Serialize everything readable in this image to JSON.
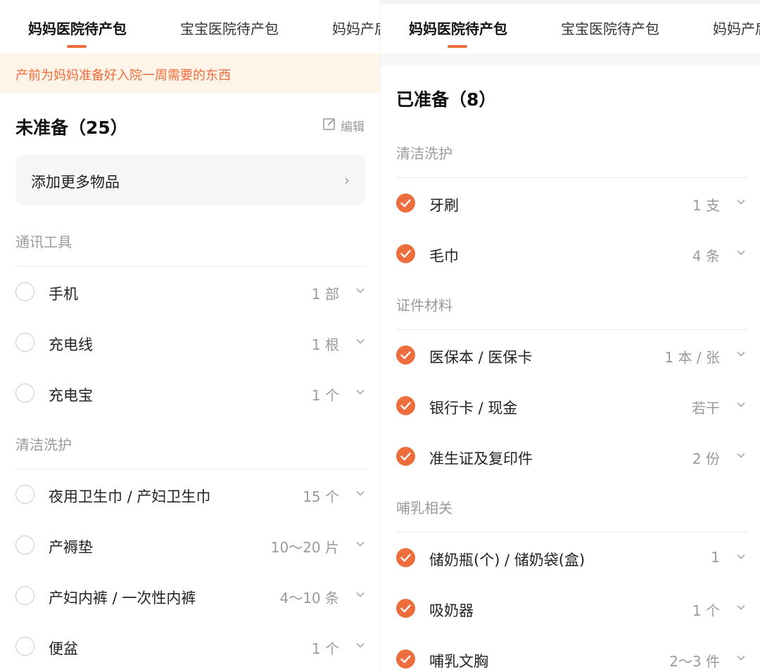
{
  "tabs": [
    "妈妈医院待产包",
    "宝宝医院待产包",
    "妈妈产后"
  ],
  "left": {
    "banner": "产前为妈妈准备好入院一周需要的东西",
    "section_title": "未准备（25）",
    "edit_label": "编辑",
    "add_more": "添加更多物品",
    "categories": [
      {
        "name": "通讯工具",
        "items": [
          {
            "name": "手机",
            "qty": "1 部"
          },
          {
            "name": "充电线",
            "qty": "1 根"
          },
          {
            "name": "充电宝",
            "qty": "1 个"
          }
        ]
      },
      {
        "name": "清洁洗护",
        "items": [
          {
            "name": "夜用卫生巾 / 产妇卫生巾",
            "qty": "15 个"
          },
          {
            "name": "产褥垫",
            "qty": "10～20 片"
          },
          {
            "name": "产妇内裤 / 一次性内裤",
            "qty": "4～10 条"
          },
          {
            "name": "便盆",
            "qty": "1 个"
          }
        ]
      }
    ]
  },
  "right": {
    "section_title": "已准备（8）",
    "categories": [
      {
        "name": "清洁洗护",
        "items": [
          {
            "name": "牙刷",
            "qty": "1 支"
          },
          {
            "name": "毛巾",
            "qty": "4 条"
          }
        ]
      },
      {
        "name": "证件材料",
        "items": [
          {
            "name": "医保本 / 医保卡",
            "qty": "1 本 / 张"
          },
          {
            "name": "银行卡 / 现金",
            "qty": "若干"
          },
          {
            "name": "准生证及复印件",
            "qty": "2 份"
          }
        ]
      },
      {
        "name": "哺乳相关",
        "items": [
          {
            "name": "储奶瓶(个) / 储奶袋(盒)",
            "qty": "1"
          },
          {
            "name": "吸奶器",
            "qty": "1 个"
          },
          {
            "name": "哺乳文胸",
            "qty": "2～3 件"
          }
        ]
      }
    ]
  },
  "colors": {
    "accent": "#ee6d3d",
    "banner_bg": "#fff4e8",
    "muted": "#9a9a9a"
  },
  "icons": {
    "edit": "edit-icon",
    "chevron_right": "chevron-right-icon",
    "chevron_down": "chevron-down-icon",
    "check": "check-icon"
  }
}
